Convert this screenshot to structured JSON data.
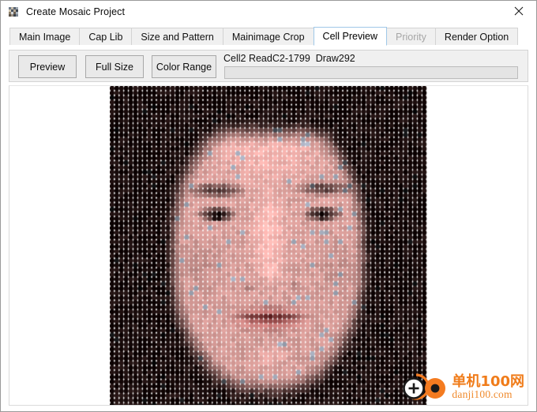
{
  "window": {
    "title": "Create Mosaic Project",
    "icon": "mosaic-app-icon",
    "close_label": "×"
  },
  "tabs": [
    {
      "label": "Main Image",
      "state": "normal"
    },
    {
      "label": "Cap Lib",
      "state": "normal"
    },
    {
      "label": "Size and Pattern",
      "state": "normal"
    },
    {
      "label": "Mainimage Crop",
      "state": "normal"
    },
    {
      "label": "Cell Preview",
      "state": "active"
    },
    {
      "label": "Priority",
      "state": "disabled"
    },
    {
      "label": "Render Option",
      "state": "normal"
    }
  ],
  "toolbar": {
    "preview_label": "Preview",
    "fullsize_label": "Full Size",
    "colorrange_label": "Color Range",
    "status_text": "Cell2 ReadC2-1799  Draw292",
    "progress_value": 0
  },
  "preview": {
    "image_description": "cell-mosaic-portrait",
    "cell_count_x": 68,
    "cell_count_y": 69,
    "cell_size_px": 5.9
  },
  "watermark": {
    "cn_text": "单机100网",
    "en_text": "danji100.com",
    "accent_color": "#f07c1a"
  },
  "colors": {
    "window_bg": "#ffffff",
    "panel_bg": "#f0f0f0",
    "tab_bg": "#f0f0f0",
    "tab_active_border": "#a0c8e8",
    "button_bg": "#e9e9e9",
    "border": "#d3d3d3",
    "text": "#111111",
    "disabled_text": "#a6a6a6"
  }
}
